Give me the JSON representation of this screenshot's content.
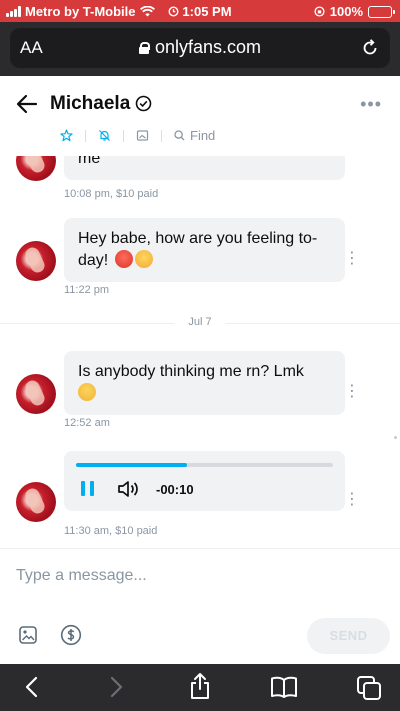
{
  "status_bar": {
    "carrier": "Metro by T-Mobile",
    "time": "1:05 PM",
    "battery": "100%",
    "battery_level": 1.0
  },
  "browser": {
    "text_size_label": "AA",
    "url": "onlyfans.com"
  },
  "chat": {
    "name": "Michaela",
    "verified": true,
    "find_label": "Find",
    "toolbar_icons": [
      "star-icon",
      "mute-icon",
      "gallery-icon",
      "search-icon"
    ]
  },
  "messages": [
    {
      "text": "me",
      "meta": "10:08 pm, $10 paid"
    },
    {
      "text": "Hey babe, how are you feeling to-day!",
      "emojis": [
        "hot-face-emoji",
        "tired-face-emoji"
      ],
      "meta": "11:22 pm"
    },
    {
      "divider": "Jul 7"
    },
    {
      "text": "Is anybody thinking me rn? Lmk",
      "emojis": [
        "pleading-face-emoji"
      ],
      "meta": "12:52 am"
    },
    {
      "type": "audio",
      "time": "-00:10",
      "progress": 0.43,
      "state": "playing",
      "meta": "11:30 am, $10 paid"
    }
  ],
  "composer": {
    "placeholder": "Type a message...",
    "send_label": "SEND"
  },
  "colors": {
    "accent": "#00aff0",
    "status_bar": "#d73a3a",
    "bubble": "#f0f2f4",
    "muted_text": "#8a96a3",
    "browser_chrome": "#2b2b2d"
  }
}
